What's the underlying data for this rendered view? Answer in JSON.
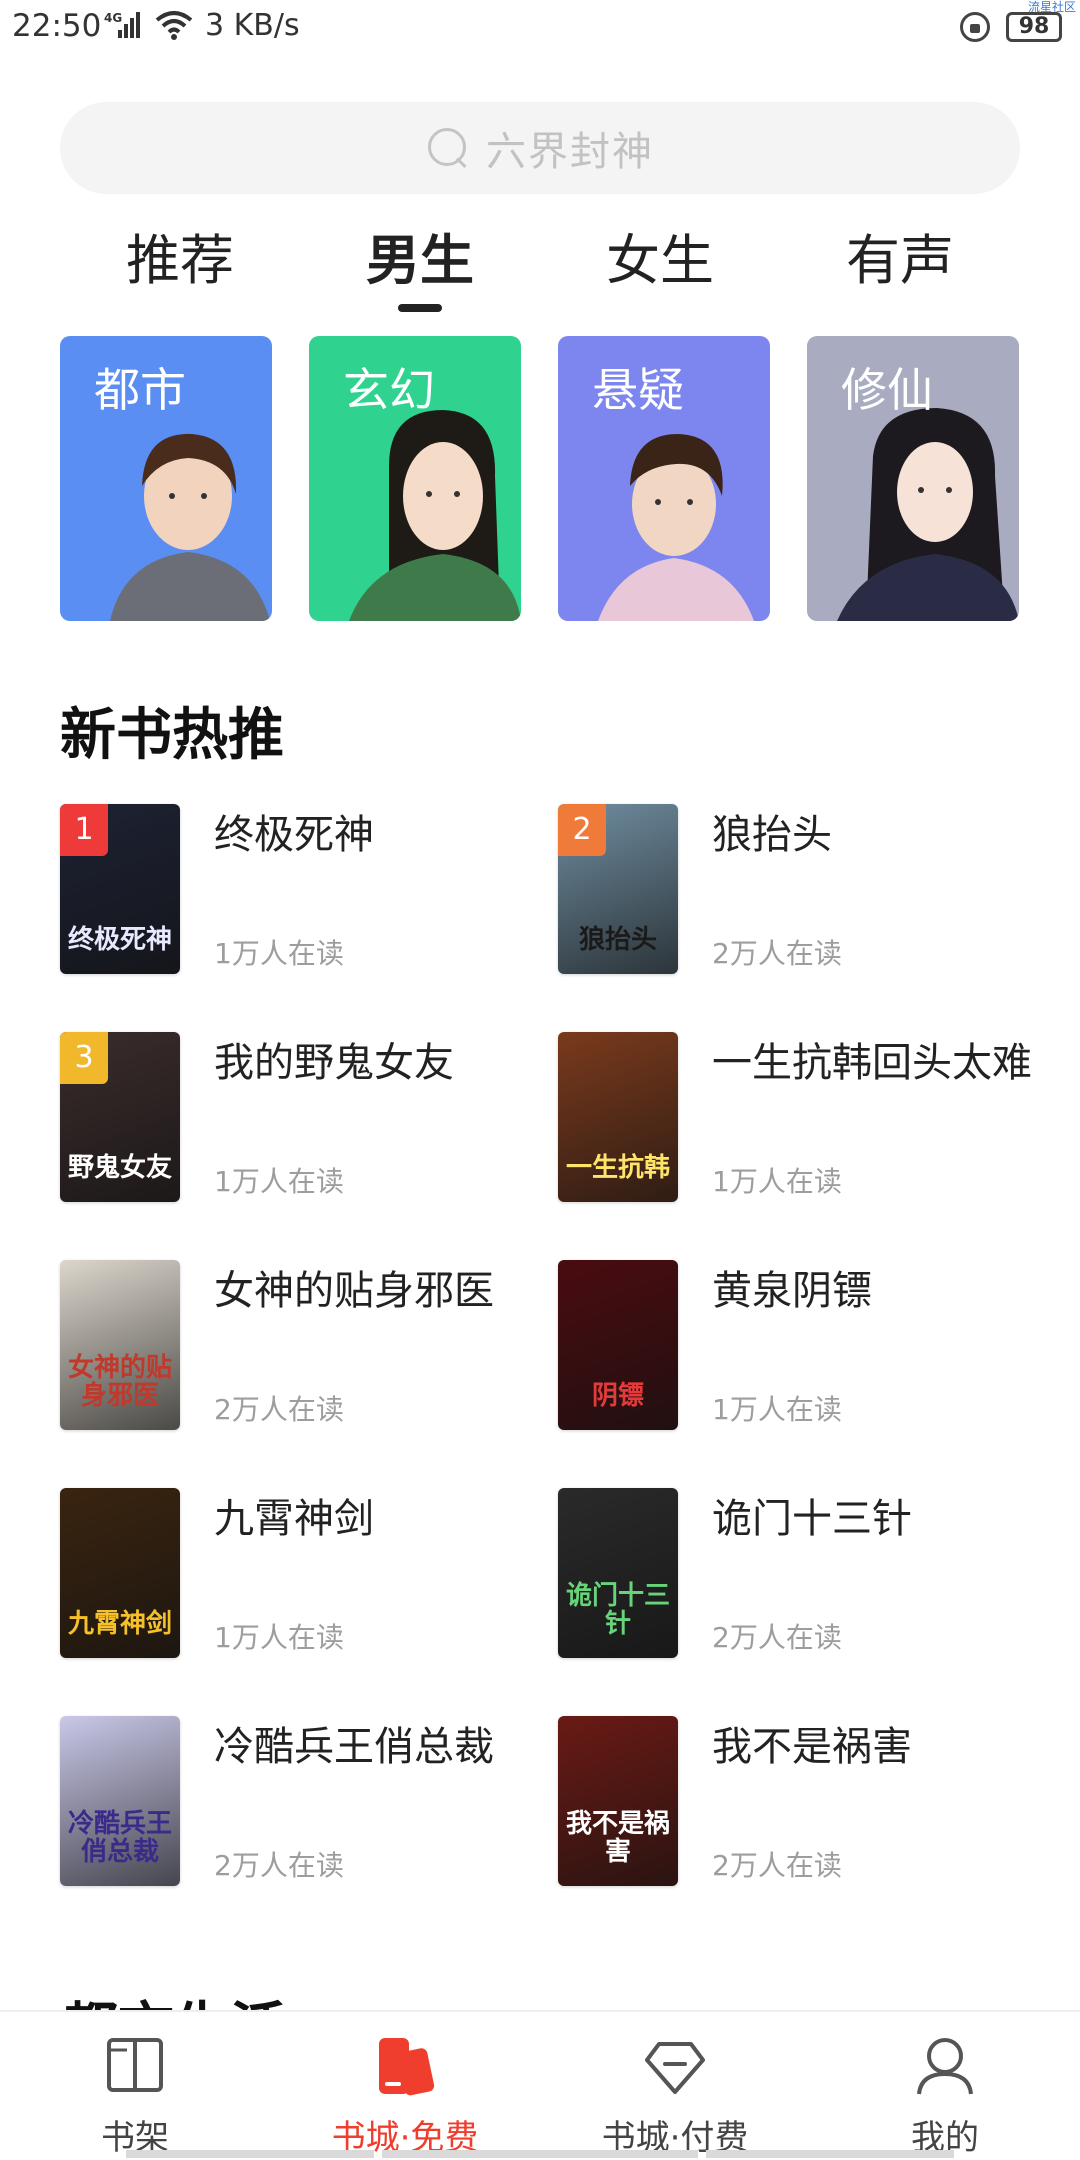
{
  "status_bar": {
    "time": "22:50",
    "network": "4G",
    "speed": "3 KB/s",
    "battery": "98",
    "corner_tag": "流星社区"
  },
  "search": {
    "placeholder": "六界封神",
    "icon": "search-icon"
  },
  "tabs": [
    {
      "label": "推荐",
      "active": false
    },
    {
      "label": "男生",
      "active": true
    },
    {
      "label": "女生",
      "active": false
    },
    {
      "label": "有声",
      "active": false
    }
  ],
  "genres": [
    {
      "label": "都市",
      "color": "#5b8ef2"
    },
    {
      "label": "玄幻",
      "color": "#2fd38f"
    },
    {
      "label": "悬疑",
      "color": "#7d86ee"
    },
    {
      "label": "修仙",
      "color": "#a9acc0"
    }
  ],
  "section": {
    "title": "新书热推",
    "next_title": "都市生活"
  },
  "books": [
    {
      "title": "终极死神",
      "readers": "1万人在读",
      "rank": "1",
      "rank_color": "#ef3a3a",
      "cover_text": "终极死神",
      "cover_bg": "#1d2233",
      "cover_fg": "#e8e8ff"
    },
    {
      "title": "狼抬头",
      "readers": "2万人在读",
      "rank": "2",
      "rank_color": "#f07a3a",
      "cover_text": "狼抬头",
      "cover_bg": "#6f8da0",
      "cover_fg": "#1a1a1a"
    },
    {
      "title": "我的野鬼女友",
      "readers": "1万人在读",
      "rank": "3",
      "rank_color": "#f2b82c",
      "cover_text": "野鬼女友",
      "cover_bg": "#3a2c2c",
      "cover_fg": "#ffffff"
    },
    {
      "title": "一生抗韩回头太难",
      "readers": "1万人在读",
      "rank": "",
      "rank_color": "",
      "cover_text": "一生抗韩",
      "cover_bg": "#7a3a1c",
      "cover_fg": "#ffe46a"
    },
    {
      "title": "女神的贴身邪医",
      "readers": "2万人在读",
      "rank": "",
      "rank_color": "",
      "cover_text": "女神的贴身邪医",
      "cover_bg": "#dcd6cc",
      "cover_fg": "#c0392b"
    },
    {
      "title": "黄泉阴镖",
      "readers": "1万人在读",
      "rank": "",
      "rank_color": "",
      "cover_text": "阴镖",
      "cover_bg": "#4a0c10",
      "cover_fg": "#e33a3a"
    },
    {
      "title": "九霄神剑",
      "readers": "1万人在读",
      "rank": "",
      "rank_color": "",
      "cover_text": "九霄神剑",
      "cover_bg": "#3a2410",
      "cover_fg": "#f5c02a"
    },
    {
      "title": "诡门十三针",
      "readers": "2万人在读",
      "rank": "",
      "rank_color": "",
      "cover_text": "诡门十三针",
      "cover_bg": "#2a2a2a",
      "cover_fg": "#67d37a"
    },
    {
      "title": "冷酷兵王俏总裁",
      "readers": "2万人在读",
      "rank": "",
      "rank_color": "",
      "cover_text": "冷酷兵王俏总裁",
      "cover_bg": "#c9c8e8",
      "cover_fg": "#3a2a8a"
    },
    {
      "title": "我不是祸害",
      "readers": "2万人在读",
      "rank": "",
      "rank_color": "",
      "cover_text": "我不是祸害",
      "cover_bg": "#6a1a14",
      "cover_fg": "#ffffff"
    }
  ],
  "bottom_nav": [
    {
      "label": "书架",
      "icon": "book-icon",
      "active": false
    },
    {
      "label": "书城·免费",
      "icon": "store-icon",
      "active": true
    },
    {
      "label": "书城·付费",
      "icon": "diamond-icon",
      "active": false
    },
    {
      "label": "我的",
      "icon": "user-icon",
      "active": false
    }
  ],
  "colors": {
    "accent": "#ef3e2e",
    "muted": "#9d9d9d"
  }
}
